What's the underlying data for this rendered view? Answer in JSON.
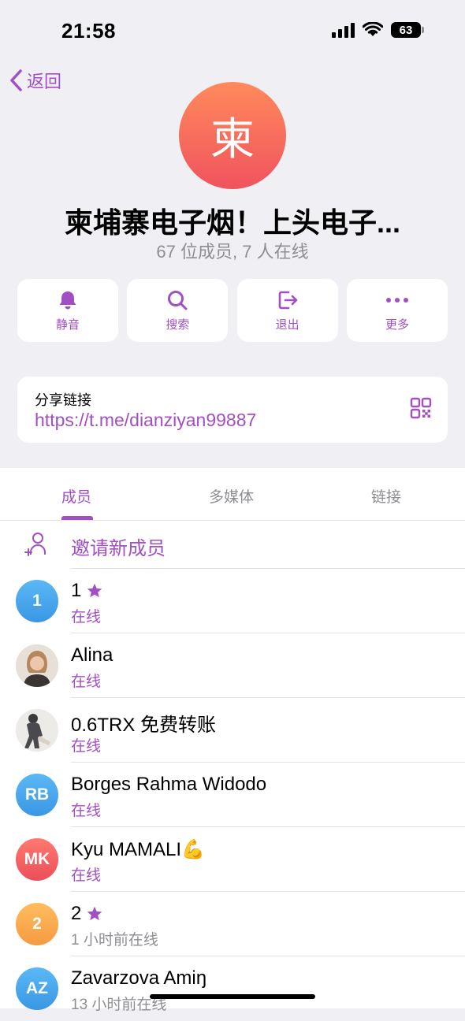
{
  "status_bar": {
    "time": "21:58",
    "battery": "63"
  },
  "nav": {
    "back_label": "返回"
  },
  "group": {
    "avatar_letter": "柬",
    "title": "柬埔寨电子烟！上头电子...",
    "subtitle": "67 位成员, 7 人在线"
  },
  "actions": {
    "mute": "静音",
    "search": "搜索",
    "leave": "退出",
    "more": "更多"
  },
  "share": {
    "title": "分享链接",
    "link": "https://t.me/dianziyan99887"
  },
  "tabs": {
    "members": "成员",
    "media": "多媒体",
    "links": "链接"
  },
  "invite": {
    "label": "邀请新成员"
  },
  "members": [
    {
      "initials": "1",
      "name": "1",
      "status": "在线",
      "star": true
    },
    {
      "initials": "",
      "name": "Alina",
      "status": "在线"
    },
    {
      "initials": "",
      "name": "0.6TRX 免费转账",
      "status": "在线"
    },
    {
      "initials": "RB",
      "name": "Borges Rahma Widodo",
      "status": "在线"
    },
    {
      "initials": "MK",
      "name": "Kyu MAMALI💪",
      "status": "在线"
    },
    {
      "initials": "2",
      "name": "2",
      "status": "1 小时前在线",
      "star": true
    },
    {
      "initials": "AZ",
      "name": "Zavarzova Amiŋ",
      "status": "13 小时前在线"
    }
  ],
  "colors": {
    "accent": "#a24fc4",
    "avatar_blue": "#3fa2e8",
    "avatar_red": "#f0565b",
    "avatar_orange": "#f7a24d"
  }
}
